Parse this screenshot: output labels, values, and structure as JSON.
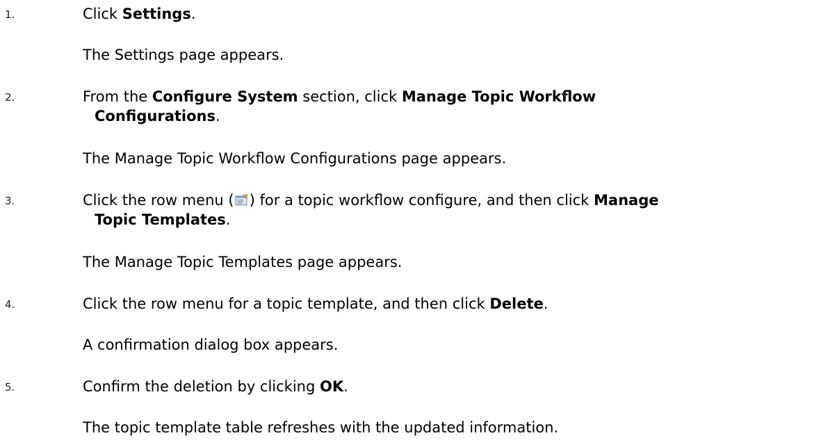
{
  "steps": [
    {
      "num": "1.",
      "pre": "Click ",
      "bold1": "Settings",
      "post": ".",
      "result": "The Settings page appears."
    },
    {
      "num": "2.",
      "pre": "From the ",
      "bold1": "Configure System",
      "mid": " section, click ",
      "bold2": "Manage Topic Workflow",
      "bold2b": "Configurations",
      "post": ".",
      "result": "The Manage Topic Workflow Configurations page appears."
    },
    {
      "num": "3.",
      "pre": "Click the row menu (",
      "icon": "row-menu-icon",
      "mid": ") for a topic workflow configure, and then click ",
      "bold1": "Manage",
      "bold1b": "Topic Templates",
      "post": ".",
      "result": "The Manage Topic Templates page appears."
    },
    {
      "num": "4.",
      "pre": "Click the row menu for a topic template, and then click ",
      "bold1": "Delete",
      "post": ".",
      "result": "A confirmation dialog box appears."
    },
    {
      "num": "5.",
      "pre": "Confirm the deletion by clicking ",
      "bold1": "OK",
      "post": ".",
      "result": "The topic template table refreshes with the updated information."
    }
  ]
}
